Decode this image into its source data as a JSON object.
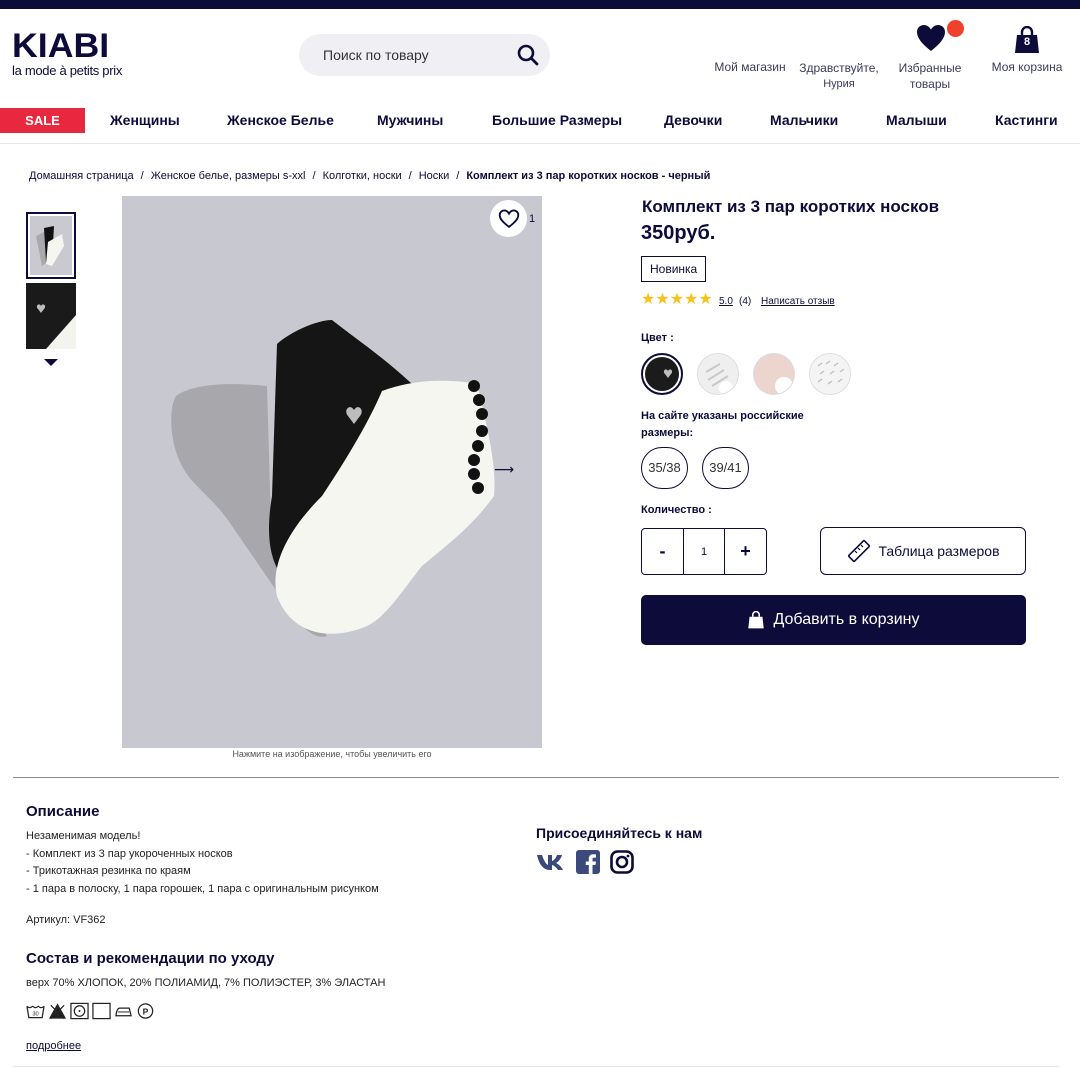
{
  "header": {
    "logo_main": "KIABI",
    "logo_sub": "la mode à petits prix",
    "search_placeholder": "Поиск по товару",
    "my_store": "Мой магазин",
    "greeting_line1": "Здравствуйте,",
    "greeting_line2": "Нурия",
    "favorites_line1": "Избранные",
    "favorites_line2": "товары",
    "cart_label": "Моя корзина",
    "cart_count": "8",
    "accent_color": "#0c0b3a",
    "badge_color": "#f0412b"
  },
  "nav": {
    "sale": "SALE",
    "items": [
      "Женщины",
      "Женское Белье",
      "Мужчины",
      "Большие Размеры",
      "Девочки",
      "Мальчики",
      "Малыши",
      "Кастинги"
    ],
    "sale_color": "#e8283f"
  },
  "breadcrumb": [
    "Домашняя страница",
    "Женское белье, размеры s-xxl",
    "Колготки, носки",
    "Носки",
    "Комплект из 3 пар коротких носков - черный"
  ],
  "gallery": {
    "wishlist_count": "1",
    "caption": "Нажмите на изображение, чтобы увеличить его"
  },
  "product": {
    "title": "Комплект из 3 пар коротких носков",
    "price": "350руб.",
    "badge": "Новинка",
    "rating": 5.0,
    "rating_label": "5.0",
    "review_count": "(4)",
    "write_review": "Написать отзыв",
    "color_label": "Цвет :",
    "color_swatches": [
      "black-heart",
      "white-print",
      "pink-dots",
      "white-pattern"
    ],
    "size_note": "На сайте указаны российские размеры:",
    "sizes": [
      "35/38",
      "39/41"
    ],
    "quantity_label": "Количество :",
    "quantity": "1",
    "qty_minus": "-",
    "qty_plus": "+",
    "size_table": "Таблица размеров",
    "add_to_cart": "Добавить в корзину"
  },
  "description": {
    "title": "Описание",
    "lines": [
      "Незаменимая модель!",
      "- Комплект из 3 пар укороченных носков",
      "- Трикотажная резинка по краям",
      "- 1 пара в полоску, 1 пара горошек, 1 пара с оригинальным рисунком"
    ],
    "article": "Артикул: VF362",
    "composition_title": "Состав и рекомендации по уходу",
    "composition": "верх 70% ХЛОПОК, 20% ПОЛИАМИД, 7% ПОЛИЭСТЕР, 3% ЭЛАСТАН",
    "more": "подробнее"
  },
  "social": {
    "title": "Присоединяйтесь к нам",
    "networks": [
      "vk-icon",
      "facebook-icon",
      "instagram-icon"
    ]
  }
}
